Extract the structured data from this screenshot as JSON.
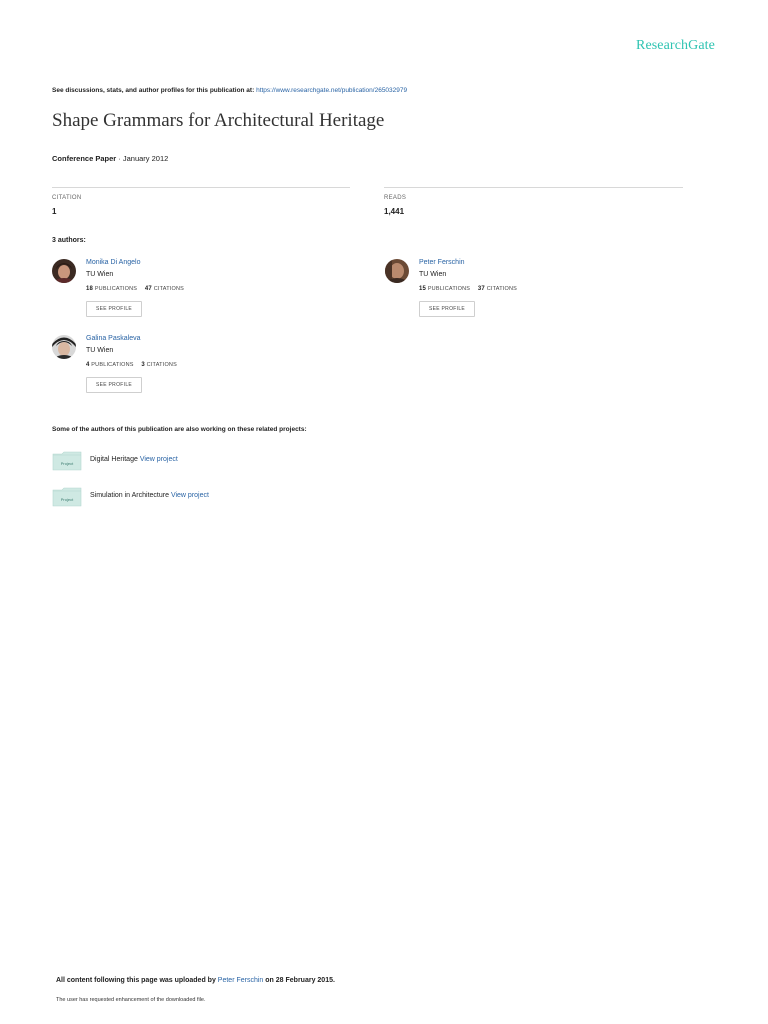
{
  "header": {
    "logo_text": "ResearchGate",
    "see_prefix": "See discussions, stats, and author profiles for this publication at:",
    "publication_url": "https://www.researchgate.net/publication/265032979"
  },
  "publication": {
    "title": "Shape Grammars for Architectural Heritage",
    "type": "Conference Paper",
    "separator": " · ",
    "date": "January 2012"
  },
  "stats": {
    "citation_label": "CITATION",
    "citation_value": "1",
    "reads_label": "READS",
    "reads_value": "1,441"
  },
  "authors_heading": "3 authors:",
  "authors": [
    {
      "name": "Monika Di Angelo",
      "affiliation": "TU Wien",
      "publications": "18",
      "publications_label": "PUBLICATIONS",
      "citations": "47",
      "citations_label": "CITATIONS",
      "button": "SEE PROFILE"
    },
    {
      "name": "Peter Ferschin",
      "affiliation": "TU Wien",
      "publications": "15",
      "publications_label": "PUBLICATIONS",
      "citations": "37",
      "citations_label": "CITATIONS",
      "button": "SEE PROFILE"
    },
    {
      "name": "Galina Paskaleva",
      "affiliation": "TU Wien",
      "publications": "4",
      "publications_label": "PUBLICATIONS",
      "citations": "3",
      "citations_label": "CITATIONS",
      "button": "SEE PROFILE"
    }
  ],
  "projects": {
    "heading": "Some of the authors of this publication are also working on these related projects:",
    "items": [
      {
        "icon_label": "Project",
        "name": "Digital Heritage",
        "link": "View project"
      },
      {
        "icon_label": "Project",
        "name": "Simulation in Architecture",
        "link": "View project"
      }
    ]
  },
  "footer": {
    "upload_prefix": "All content following this page was uploaded by",
    "uploader": "Peter Ferschin",
    "upload_suffix": "on 28 February 2015.",
    "note": "The user has requested enhancement of the downloaded file."
  },
  "colors": {
    "brand": "#2fc4b2",
    "link": "#2a64a5",
    "project_icon": "#cfe9e3"
  }
}
